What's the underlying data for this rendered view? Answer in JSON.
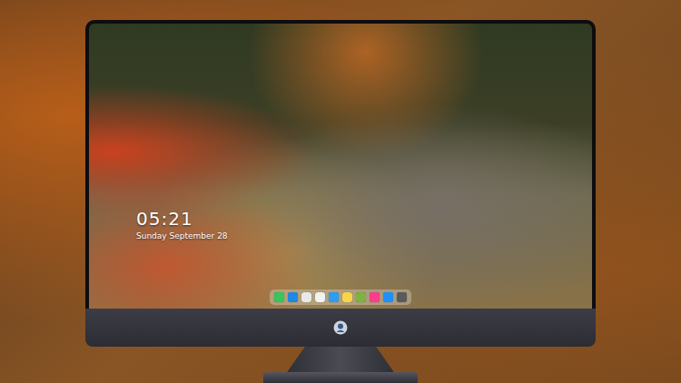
{
  "lock_screen": {
    "time": "05:21",
    "date": "Sunday September 28"
  },
  "dock": {
    "items": [
      {
        "color": "#34c759"
      },
      {
        "color": "#1e88e5"
      },
      {
        "color": "#e9e9e9"
      },
      {
        "color": "#f2f2f2"
      },
      {
        "color": "#2a9df4"
      },
      {
        "color": "#f7d54a"
      },
      {
        "color": "#7cb342"
      },
      {
        "color": "#fc3c8c"
      },
      {
        "color": "#1e90ff"
      },
      {
        "color": "#5a5a5a"
      }
    ]
  }
}
